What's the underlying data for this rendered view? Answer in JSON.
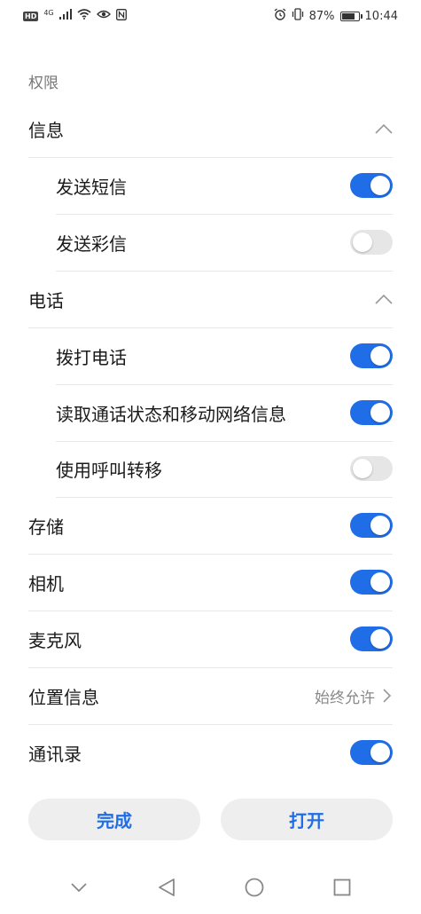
{
  "status_bar": {
    "hd": "HD",
    "network": "4G",
    "battery_percent": "87%",
    "battery_level": 0.87,
    "time": "10:44",
    "icons": [
      "signal-icon",
      "wifi-icon",
      "eye-icon",
      "nfc-icon",
      "alarm-icon",
      "vibrate-icon",
      "battery-icon"
    ]
  },
  "section_title": "权限",
  "groups": {
    "messages": {
      "label": "信息",
      "items": {
        "send_sms": {
          "label": "发送短信",
          "enabled": true
        },
        "send_mms": {
          "label": "发送彩信",
          "enabled": false
        }
      }
    },
    "phone": {
      "label": "电话",
      "items": {
        "make_calls": {
          "label": "拨打电话",
          "enabled": true
        },
        "read_phone_state": {
          "label": "读取通话状态和移动网络信息",
          "enabled": true
        },
        "call_forwarding": {
          "label": "使用呼叫转移",
          "enabled": false
        }
      }
    }
  },
  "permissions": {
    "storage": {
      "label": "存储",
      "enabled": true
    },
    "camera": {
      "label": "相机",
      "enabled": true
    },
    "microphone": {
      "label": "麦克风",
      "enabled": true
    },
    "location": {
      "label": "位置信息",
      "value": "始终允许"
    },
    "contacts": {
      "label": "通讯录",
      "enabled": true
    }
  },
  "buttons": {
    "done": "完成",
    "open": "打开"
  },
  "colors": {
    "accent": "#1f6ee8",
    "switch_off": "#e6e6e6",
    "button_bg": "#eeeeee"
  }
}
